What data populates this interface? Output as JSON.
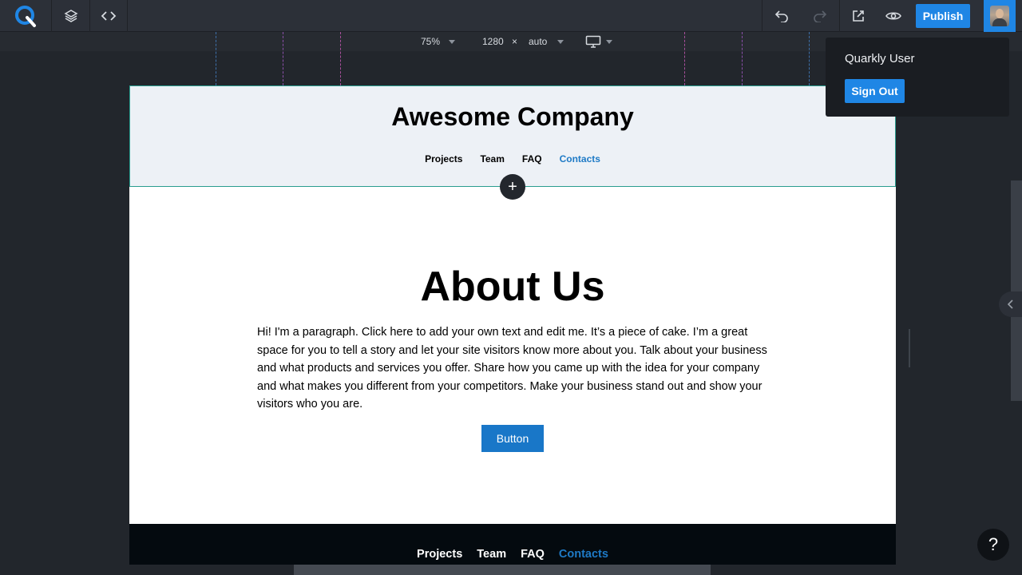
{
  "toolbar": {
    "publish_label": "Publish",
    "icons": [
      "quarkly-logo-icon",
      "layers-icon",
      "code-icon",
      "undo-icon",
      "redo-icon",
      "external-link-icon",
      "eye-icon",
      "avatar"
    ]
  },
  "subtoolbar": {
    "zoom": "75%",
    "width": "1280",
    "times": "×",
    "height": "auto",
    "device_icon": "monitor-icon"
  },
  "user_menu": {
    "name": "Quarkly User",
    "sign_out_label": "Sign Out"
  },
  "site": {
    "header": {
      "title": "Awesome Company",
      "nav": [
        {
          "label": "Projects",
          "active": false
        },
        {
          "label": "Team",
          "active": false
        },
        {
          "label": "FAQ",
          "active": false
        },
        {
          "label": "Contacts",
          "active": true
        }
      ]
    },
    "add_section_label": "+",
    "about": {
      "title": "About Us",
      "text": "Hi! I'm a paragraph. Click here to add your own text and edit me. It’s a piece of cake. I’m a great space for you to tell a story and let your site visitors know more about you. Talk about your business and what products and services you offer. Share how you came up with the idea for your company and what makes you different from your competitors. Make your business stand out and show your visitors who you are.",
      "button_label": "Button"
    },
    "footer": {
      "nav": [
        {
          "label": "Projects",
          "active": false
        },
        {
          "label": "Team",
          "active": false
        },
        {
          "label": "FAQ",
          "active": false
        },
        {
          "label": "Contacts",
          "active": true
        }
      ]
    }
  },
  "help_label": "?",
  "colors": {
    "accent": "#1f86e5",
    "link_active": "#1e7ac6",
    "editor_bg": "#22262c",
    "header_bg": "#edf1f6",
    "footer_bg": "#040a0f"
  }
}
